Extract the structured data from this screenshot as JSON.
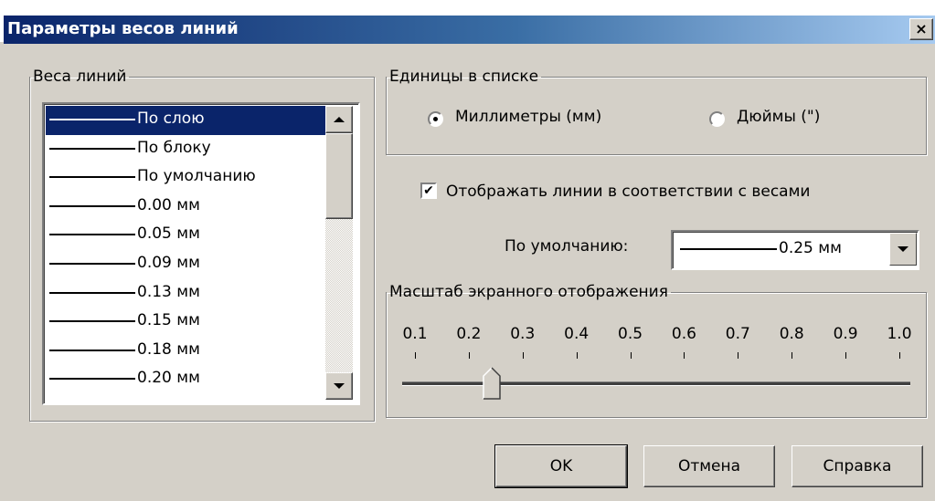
{
  "window": {
    "title": "Параметры весов линий",
    "close_glyph": "×"
  },
  "weights_group": {
    "legend": "Веса линий",
    "items": [
      "По слою",
      "По блоку",
      "По умолчанию",
      "0.00 мм",
      "0.05 мм",
      "0.09 мм",
      "0.13 мм",
      "0.15 мм",
      "0.18 мм",
      "0.20 мм"
    ],
    "selected": "По слою"
  },
  "units_group": {
    "legend": "Единицы в списке",
    "options": [
      "Миллиметры (мм)",
      "Дюймы (\")"
    ],
    "selected": "Миллиметры (мм)"
  },
  "display": {
    "checkbox_label": "Отображать линии в соответствии с весами",
    "checked": true,
    "checkmark_glyph": "✔"
  },
  "default": {
    "label": "По умолчанию:",
    "value": "0.25 мм"
  },
  "scale_group": {
    "legend": "Масштаб экранного отображения",
    "ticks": [
      "0.1",
      "0.2",
      "0.3",
      "0.4",
      "0.5",
      "0.6",
      "0.7",
      "0.8",
      "0.9",
      "1.0"
    ],
    "value": 0.25
  },
  "buttons": {
    "ok": "OK",
    "cancel": "Отмена",
    "help": "Справка"
  },
  "icons": {
    "close": "close-icon",
    "scroll_up": "arrow-up-icon",
    "scroll_down": "arrow-down-icon",
    "dropdown": "chevron-down-icon"
  }
}
